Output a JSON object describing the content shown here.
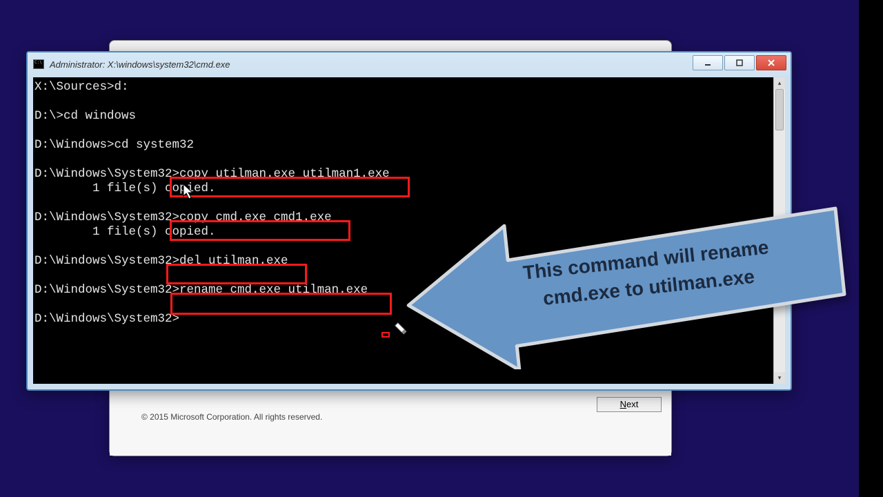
{
  "colors": {
    "background": "#1a0f5c",
    "highlight_border": "#ff1a1a",
    "arrow_fill": "#6694c5",
    "arrow_border": "#d4d9df"
  },
  "setup": {
    "copyright": "© 2015 Microsoft Corporation. All rights reserved.",
    "next_label": "Next"
  },
  "titlebar": {
    "title": "Administrator: X:\\windows\\system32\\cmd.exe"
  },
  "console": {
    "lines": [
      "X:\\Sources>d:",
      "",
      "D:\\>cd windows",
      "",
      "D:\\Windows>cd system32",
      "",
      "D:\\Windows\\System32>copy utilman.exe utilman1.exe",
      "        1 file(s) copied.",
      "",
      "D:\\Windows\\System32>copy cmd.exe cmd1.exe",
      "        1 file(s) copied.",
      "",
      "D:\\Windows\\System32>del utilman.exe",
      "",
      "D:\\Windows\\System32>rename cmd.exe utilman.exe",
      "",
      "D:\\Windows\\System32>"
    ]
  },
  "callout": {
    "line1": "This command will rename",
    "line2": "cmd.exe to utilman.exe"
  }
}
